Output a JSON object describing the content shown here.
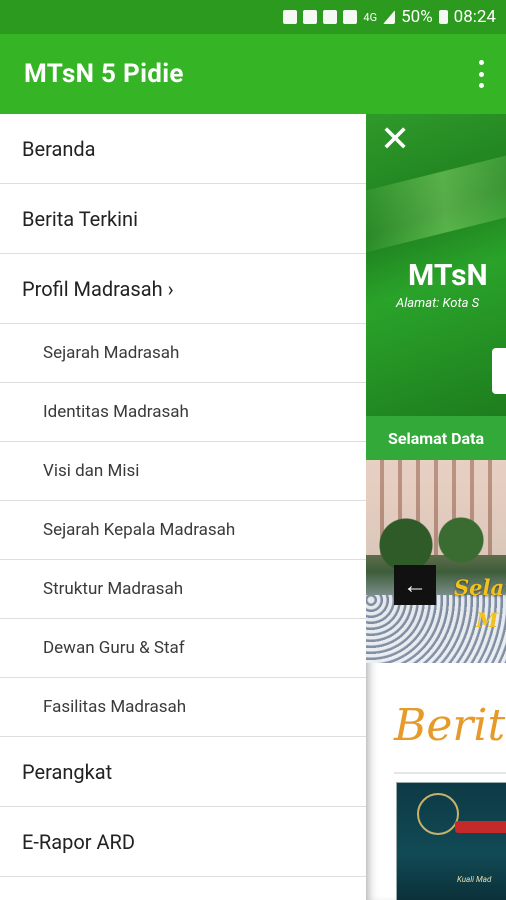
{
  "status_bar": {
    "lte_label": "4G",
    "battery": "50%",
    "time": "08:24"
  },
  "app_bar": {
    "title": "MTsN 5 Pidie"
  },
  "drawer": {
    "items": [
      {
        "label": "Beranda",
        "level": 0
      },
      {
        "label": "Berita Terkini",
        "level": 0
      },
      {
        "label": "Profil Madrasah ›",
        "level": 0
      },
      {
        "label": "Sejarah Madrasah",
        "level": 1
      },
      {
        "label": "Identitas Madrasah",
        "level": 1
      },
      {
        "label": "Visi dan Misi",
        "level": 1
      },
      {
        "label": "Sejarah Kepala Madrasah",
        "level": 1
      },
      {
        "label": "Struktur Madrasah",
        "level": 1
      },
      {
        "label": "Dewan Guru & Staf",
        "level": 1
      },
      {
        "label": "Fasilitas Madrasah",
        "level": 1
      },
      {
        "label": "Perangkat",
        "level": 0
      },
      {
        "label": "E-Rapor ARD",
        "level": 0
      }
    ]
  },
  "content": {
    "hero_title": "MTsN",
    "hero_subtitle": "Alamat: Kota S",
    "welcome_text": "Selamat Data",
    "banner_text_1": "Selam",
    "banner_text_2": "M",
    "news_heading": "Berita",
    "thumb_caption": "Kuali Mad"
  },
  "colors": {
    "status_bar": "#2c9a1e",
    "app_bar": "#35b526",
    "welcome_bar": "#33a93a",
    "news_heading": "#e59a2a"
  }
}
